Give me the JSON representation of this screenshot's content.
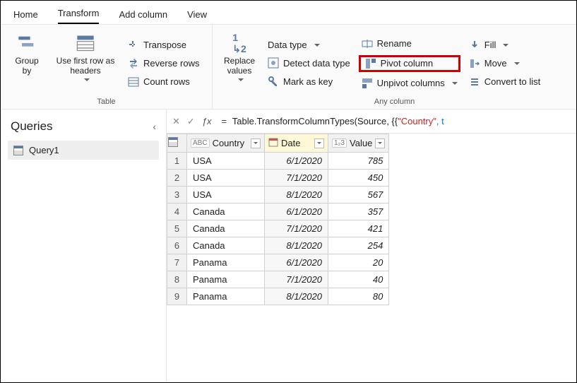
{
  "tabs": {
    "home": "Home",
    "transform": "Transform",
    "add": "Add column",
    "view": "View"
  },
  "ribbon": {
    "group_by": "Group\nby",
    "use_first_row": "Use first row as\nheaders",
    "transpose": "Transpose",
    "reverse": "Reverse rows",
    "count": "Count rows",
    "replace": "Replace\nvalues",
    "data_type": "Data type",
    "detect": "Detect data type",
    "mark_key": "Mark as key",
    "rename": "Rename",
    "pivot": "Pivot column",
    "unpivot": "Unpivot columns",
    "fill": "Fill",
    "move": "Move",
    "convert": "Convert to list",
    "table_group": "Table",
    "any_col_group": "Any column"
  },
  "queries": {
    "title": "Queries",
    "item1": "Query1"
  },
  "formula": {
    "prefix": "= ",
    "fn": "Table.TransformColumnTypes(Source, {{",
    "str": "\"Country\"",
    "tail": ", t"
  },
  "grid": {
    "headers": {
      "country": "Country",
      "date": "Date",
      "value": "Value"
    },
    "type_text": "ABC",
    "type_num": "1₂3",
    "rows": [
      {
        "n": "1",
        "country": "USA",
        "date": "6/1/2020",
        "value": "785"
      },
      {
        "n": "2",
        "country": "USA",
        "date": "7/1/2020",
        "value": "450"
      },
      {
        "n": "3",
        "country": "USA",
        "date": "8/1/2020",
        "value": "567"
      },
      {
        "n": "4",
        "country": "Canada",
        "date": "6/1/2020",
        "value": "357"
      },
      {
        "n": "5",
        "country": "Canada",
        "date": "7/1/2020",
        "value": "421"
      },
      {
        "n": "6",
        "country": "Canada",
        "date": "8/1/2020",
        "value": "254"
      },
      {
        "n": "7",
        "country": "Panama",
        "date": "6/1/2020",
        "value": "20"
      },
      {
        "n": "8",
        "country": "Panama",
        "date": "7/1/2020",
        "value": "40"
      },
      {
        "n": "9",
        "country": "Panama",
        "date": "8/1/2020",
        "value": "80"
      }
    ]
  }
}
